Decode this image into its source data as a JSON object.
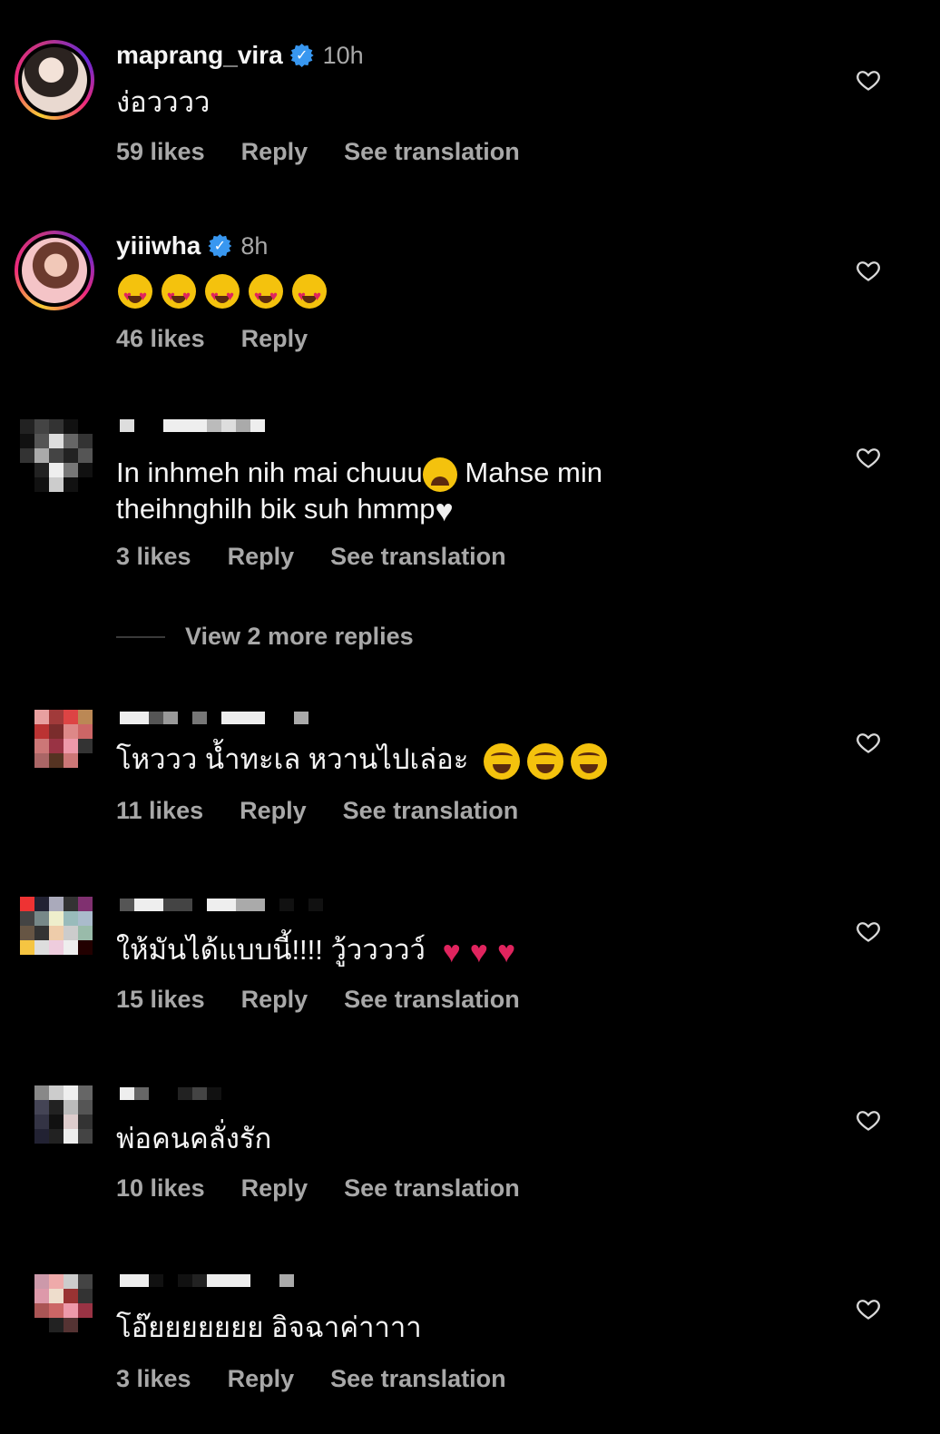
{
  "comments": [
    {
      "username": "maprang_vira",
      "time": "10h",
      "text": "ง่อวววว",
      "likes": "59 likes",
      "reply": "Reply",
      "translate": "See translation"
    },
    {
      "username": "yiiiwha",
      "time": "8h",
      "text": "",
      "likes": "46 likes",
      "reply": "Reply"
    },
    {
      "username": "",
      "text_line1": "In inhmeh nih mai chuuu",
      "text_line1b": " Mahse min",
      "text_line2": "theihnghilh bik suh hmmp",
      "likes": "3 likes",
      "reply": "Reply",
      "translate": "See translation"
    },
    {
      "username": "",
      "text": "โหววว น้ำทะเล หวานไปเล่อะ",
      "likes": "11 likes",
      "reply": "Reply",
      "translate": "See translation"
    },
    {
      "username": "",
      "text": "ให้มันได้แบบนี้!!!! วู้ววววว์",
      "likes": "15 likes",
      "reply": "Reply",
      "translate": "See translation"
    },
    {
      "username": "",
      "text": "พ่อคนคลั่งรัก",
      "likes": "10 likes",
      "reply": "Reply",
      "translate": "See translation"
    },
    {
      "username": "",
      "text": "โอ๊ยยยยยยย อิจฉาค่าาาา",
      "likes": "3 likes",
      "reply": "Reply",
      "translate": "See translation"
    }
  ],
  "view_more": "View 2 more replies",
  "icons": {
    "like": "heart-outline-icon",
    "verified": "verified-badge-icon"
  },
  "colors": {
    "background": "#000000",
    "primary_text": "#f5f5f5",
    "secondary_text": "#a8a8a8",
    "verified": "#3897f0"
  }
}
